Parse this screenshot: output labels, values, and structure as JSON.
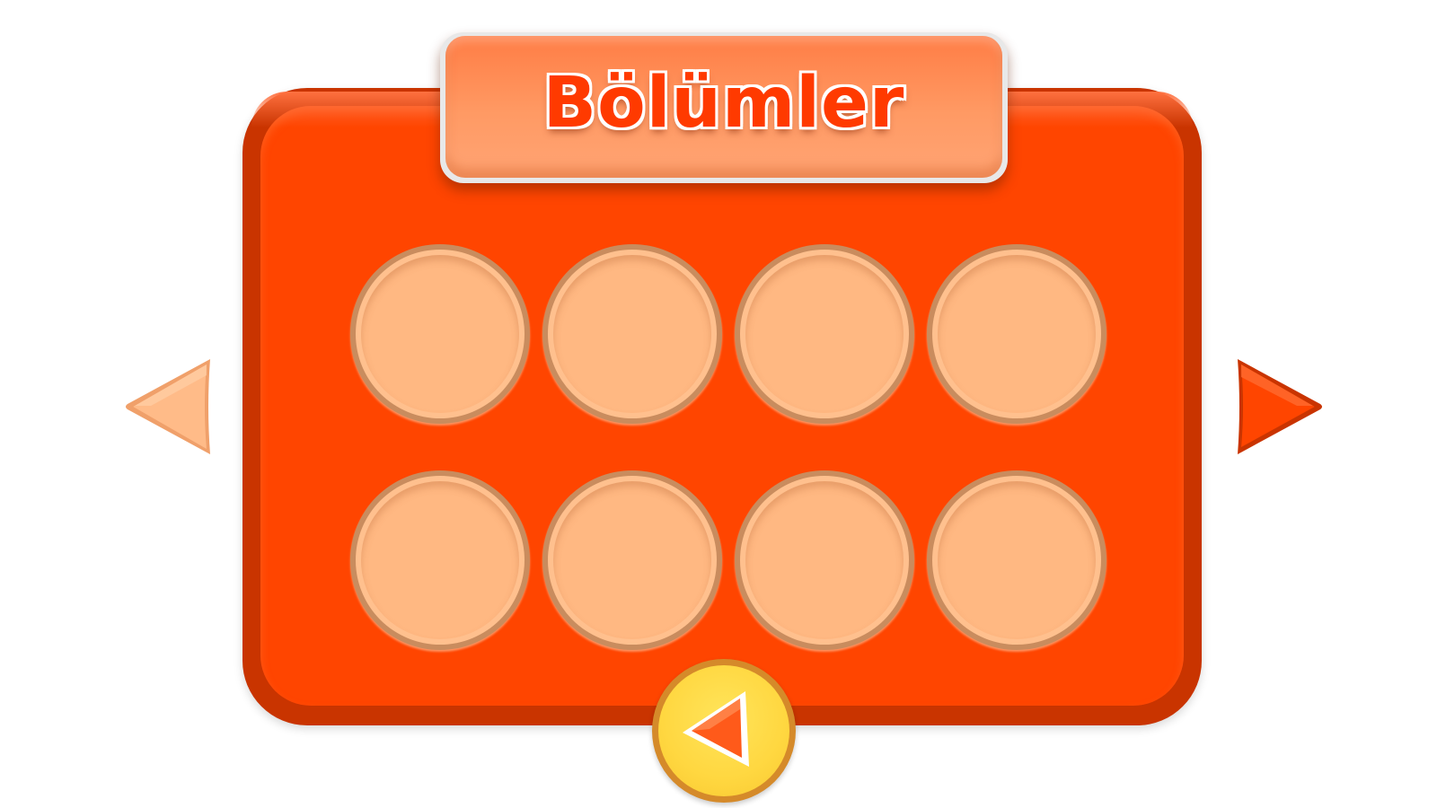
{
  "screen": {
    "title": "Bölümler"
  },
  "levels": {
    "rows": 2,
    "columns": 4,
    "slots": [
      {
        "state": "empty"
      },
      {
        "state": "empty"
      },
      {
        "state": "empty"
      },
      {
        "state": "empty"
      },
      {
        "state": "empty"
      },
      {
        "state": "empty"
      },
      {
        "state": "empty"
      },
      {
        "state": "empty"
      }
    ]
  },
  "navigation": {
    "prev_icon": "triangle-left-icon",
    "next_icon": "triangle-right-icon",
    "back_icon": "back-arrow-icon",
    "prev_enabled": false,
    "next_enabled": true
  },
  "colors": {
    "panel": "#ff4500",
    "panel_border": "#c93400",
    "title_plaque": "#ff9a64",
    "title_text": "#ff3a00",
    "slot": "#ffb882",
    "disabled_arrow": "#ffb882",
    "active_arrow": "#ff4500",
    "back_button": "#ffd740"
  }
}
